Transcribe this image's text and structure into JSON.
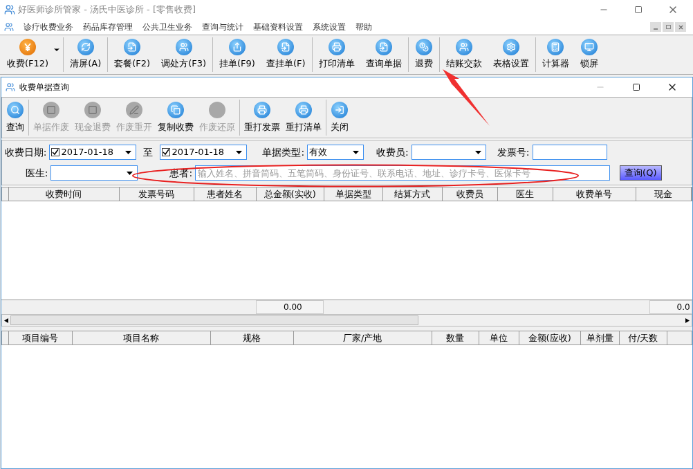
{
  "window": {
    "title": "好医师诊所管家 - 汤氏中医诊所 - [零售收费]"
  },
  "menu": [
    "诊疗收费业务",
    "药品库存管理",
    "公共卫生业务",
    "查询与统计",
    "基础资料设置",
    "系统设置",
    "帮助"
  ],
  "toolbar": [
    {
      "label": "收费(F12)",
      "kind": "yen",
      "dropdown": true
    },
    {
      "label": "清屏(A)",
      "kind": "refresh",
      "dropdown": false
    },
    {
      "label": "套餐(F2)",
      "kind": "document",
      "dropdown": false
    },
    {
      "label": "调处方(F3)",
      "kind": "people",
      "dropdown": false
    },
    {
      "label": "挂单(F9)",
      "kind": "share",
      "dropdown": false
    },
    {
      "label": "查挂单(F)",
      "kind": "document",
      "dropdown": false
    },
    {
      "label": "打印清单",
      "kind": "printer",
      "dropdown": false
    },
    {
      "label": "查询单据",
      "kind": "document",
      "dropdown": false
    },
    {
      "label": "退费",
      "kind": "coins",
      "dropdown": false
    },
    {
      "label": "结账交款",
      "kind": "people",
      "dropdown": false
    },
    {
      "label": "表格设置",
      "kind": "gear",
      "dropdown": false
    },
    {
      "label": "计算器",
      "kind": "calculator",
      "dropdown": false
    },
    {
      "label": "锁屏",
      "kind": "monitor",
      "dropdown": false
    }
  ],
  "dialog": {
    "title": "收费单据查询",
    "toolbar": [
      {
        "label": "查询",
        "kind": "search",
        "disabled": false
      },
      {
        "label": "单据作废",
        "kind": "frame",
        "disabled": true
      },
      {
        "label": "现金退费",
        "kind": "frame",
        "disabled": true
      },
      {
        "label": "作废重开",
        "kind": "pen",
        "disabled": true
      },
      {
        "label": "复制收费",
        "kind": "copy",
        "disabled": false
      },
      {
        "label": "作废还原",
        "kind": "blank",
        "disabled": true
      },
      {
        "label": "重打发票",
        "kind": "printer",
        "disabled": false
      },
      {
        "label": "重打清单",
        "kind": "printer",
        "disabled": false
      },
      {
        "label": "关闭",
        "kind": "exit",
        "disabled": false
      }
    ],
    "filters": {
      "date_label": "收费日期:",
      "date_from": {
        "checked": true,
        "value": "2017-01-18"
      },
      "to_label": "至",
      "date_to": {
        "checked": true,
        "value": "2017-01-18"
      },
      "type_label": "单据类型:",
      "type_value": "有效",
      "cashier_label": "收费员:",
      "invoice_label": "发票号:",
      "doctor_label": "医生:",
      "patient_label": "患者:",
      "patient_placeholder": "输入姓名、拼音简码、五笔简码、身份证号、联系电话、地址、诊疗卡号、医保卡号",
      "query_button": "查询(Q)"
    },
    "bills_table": {
      "columns": [
        "收费时间",
        "发票号码",
        "患者姓名",
        "总金额(实收)",
        "单据类型",
        "结算方式",
        "收费员",
        "医生",
        "收费单号",
        "现金"
      ],
      "total_amount": "0.00",
      "total_cash": "0.0"
    },
    "items_table": {
      "columns": [
        "项目编号",
        "项目名称",
        "规格",
        "厂家/产地",
        "数量",
        "单位",
        "金额(应收)",
        "单剂量",
        "付/天数"
      ]
    }
  }
}
